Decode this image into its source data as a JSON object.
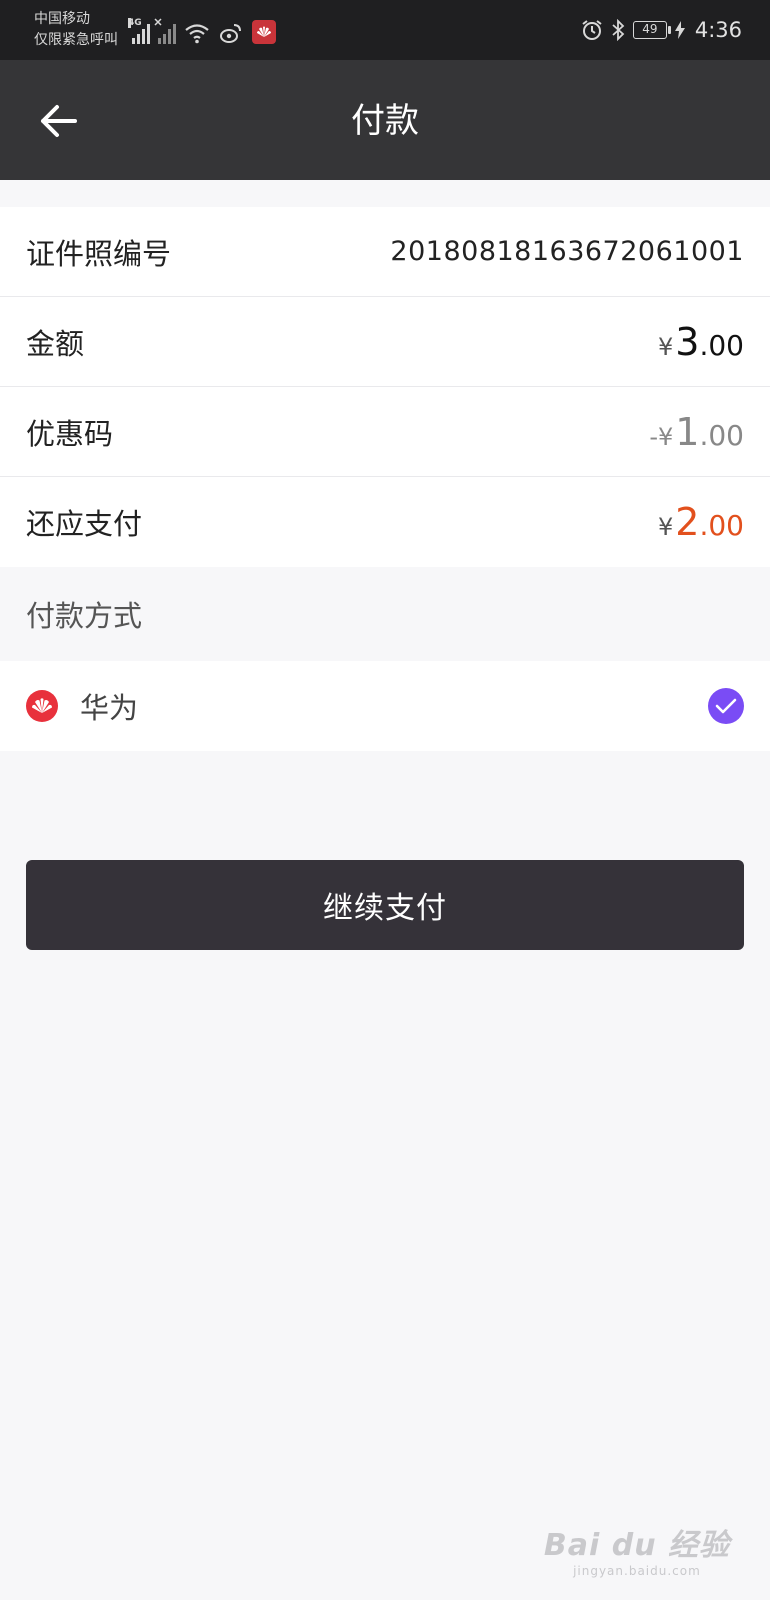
{
  "status_bar": {
    "carrier_line1": "中国移动",
    "carrier_line2": "仅限紧急呼叫",
    "network_tag": "4G",
    "battery_level": "49",
    "time": "4:36"
  },
  "app_bar": {
    "title": "付款"
  },
  "rows": [
    {
      "label": "证件照编号",
      "value": "20180818163672061001"
    },
    {
      "label": "金额",
      "currency": "¥",
      "integer": "3",
      "decimals": ".00"
    },
    {
      "label": "优惠码",
      "currency": "-¥",
      "integer": "1",
      "decimals": ".00"
    },
    {
      "label": "还应支付",
      "currency": "¥",
      "integer": "2",
      "decimals": ".00"
    }
  ],
  "payment_section": {
    "label": "付款方式",
    "method_name": "华为",
    "selected": true
  },
  "pay_button_label": "继续支付",
  "watermark": {
    "top": "Bai du 经验",
    "bottom": "jingyan.baidu.com"
  },
  "colors": {
    "accent_orange": "#e2501d",
    "check_purple": "#7a4cf5",
    "huawei_red": "#e8313c",
    "app_bar": "#353537"
  }
}
